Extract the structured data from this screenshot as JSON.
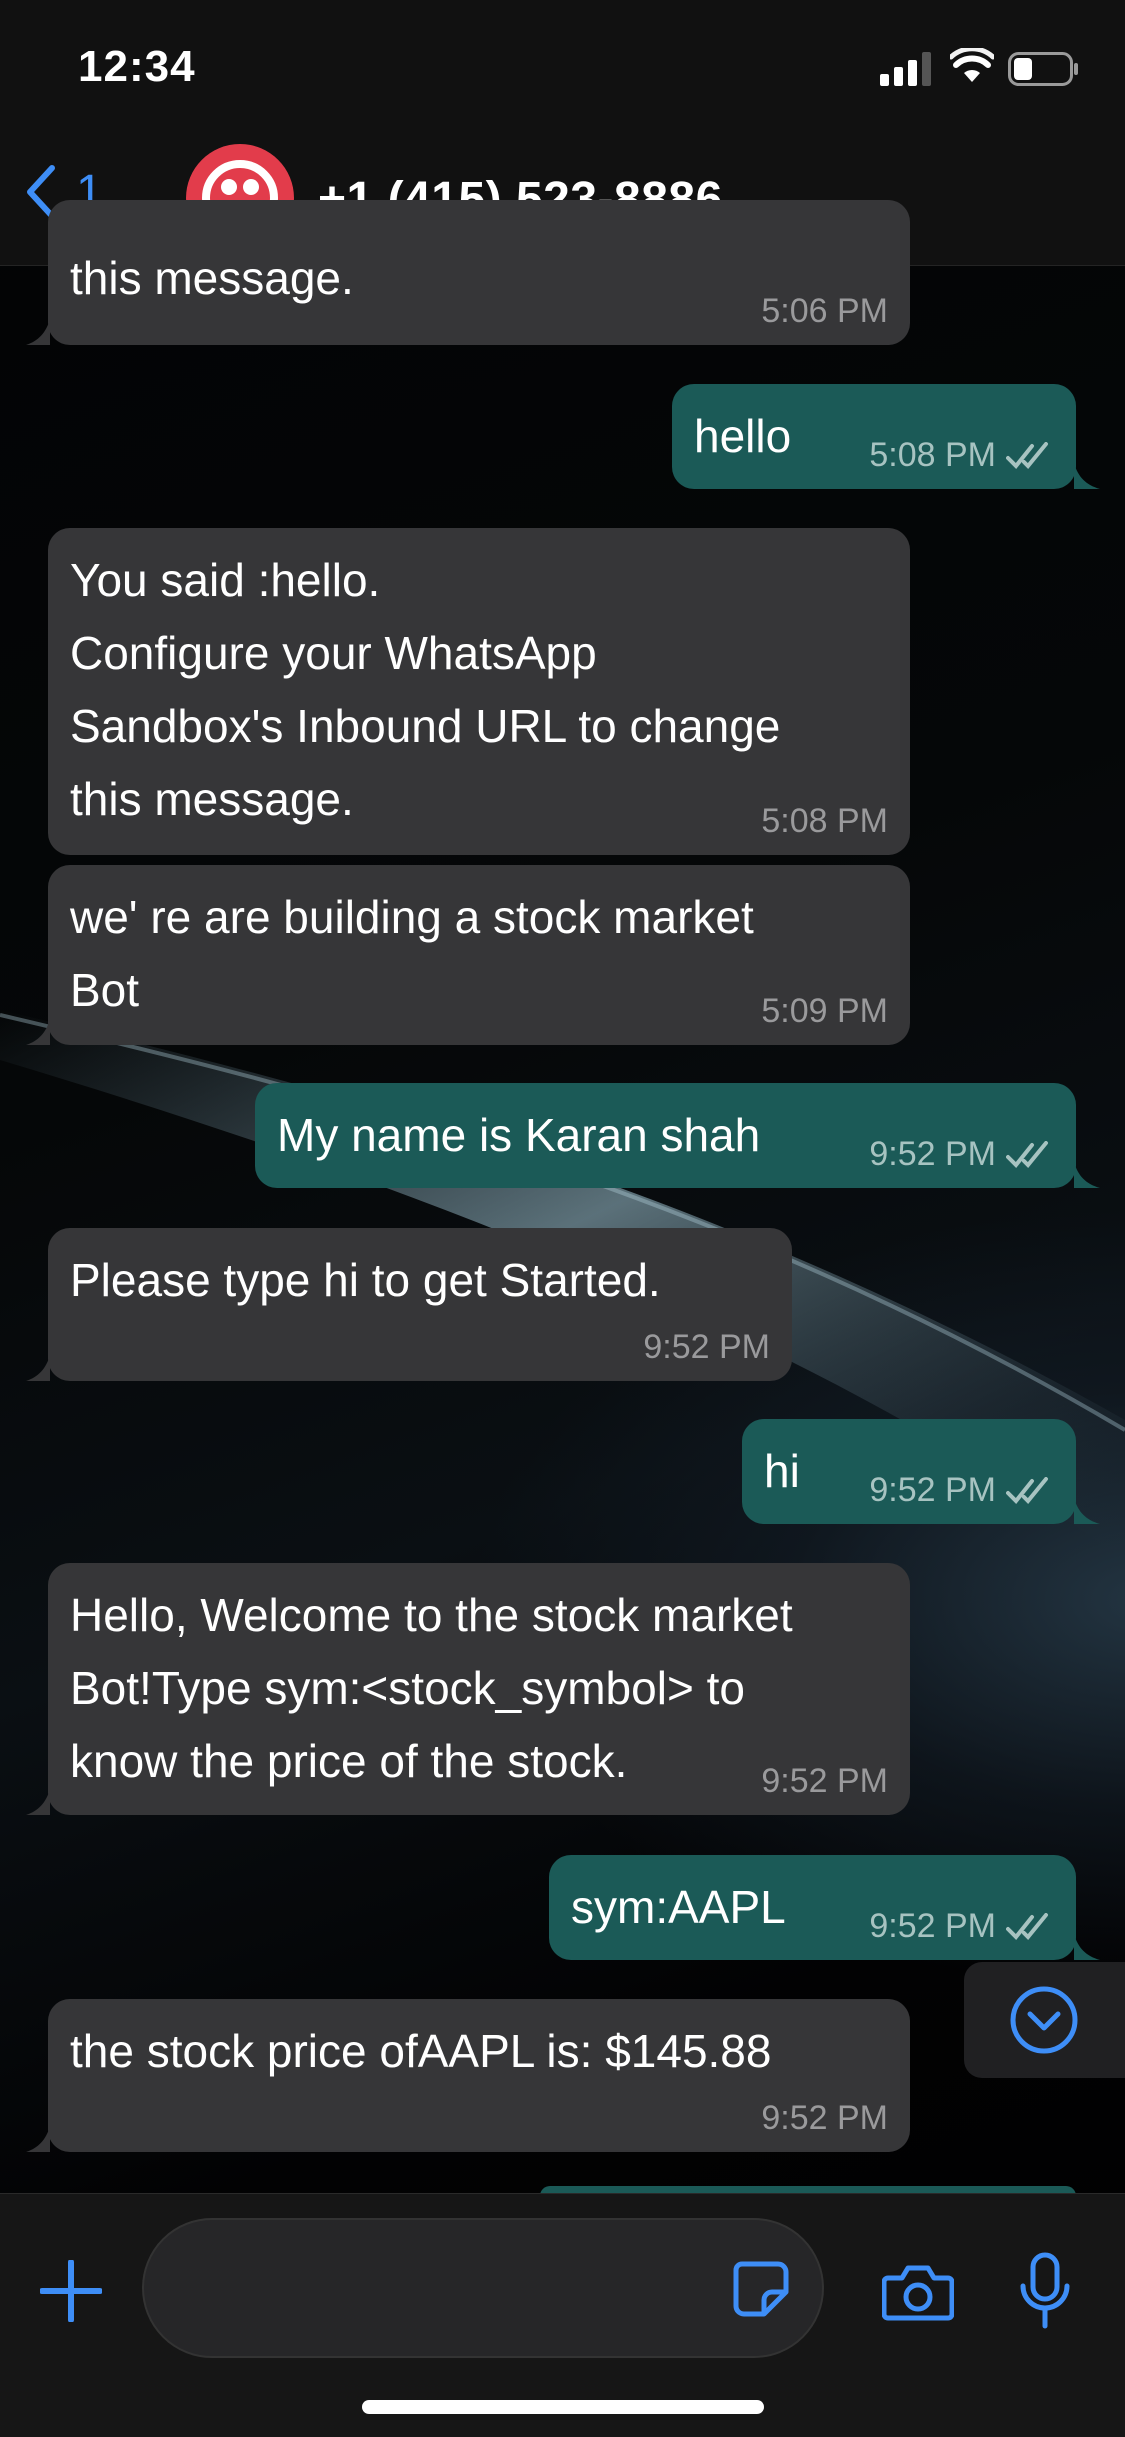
{
  "status_bar": {
    "time": "12:34"
  },
  "header": {
    "back_count": "1",
    "contact": "+1 (415) 523-8886"
  },
  "messages": [
    {
      "dir": "in",
      "text": "this message.",
      "time": "5:06 PM"
    },
    {
      "dir": "out",
      "text": "hello",
      "time": "5:08 PM"
    },
    {
      "dir": "in",
      "text": "You said :hello.\n Configure your WhatsApp\nSandbox's Inbound URL to change\nthis message.",
      "time": "5:08 PM"
    },
    {
      "dir": "in",
      "text": "we' re are building a stock market\nBot",
      "time": "5:09 PM"
    },
    {
      "dir": "out",
      "text": "My name is Karan shah",
      "time": "9:52 PM"
    },
    {
      "dir": "in",
      "text": "Please type hi to get Started.",
      "time": "9:52 PM"
    },
    {
      "dir": "out",
      "text": "hi",
      "time": "9:52 PM"
    },
    {
      "dir": "in",
      "text": "Hello, Welcome to the stock market\nBot!Type sym:<stock_symbol> to\nknow the price of the stock.",
      "time": "9:52 PM"
    },
    {
      "dir": "out",
      "text": "sym:AAPL",
      "time": "9:52 PM"
    },
    {
      "dir": "in",
      "text": "the stock price ofAAPL is: $145.88",
      "time": "9:52 PM"
    }
  ],
  "colors": {
    "accent": "#3e8ef7",
    "incoming_bubble": "#363638",
    "outgoing_bubble": "#1b5a57",
    "avatar": "#e23c4b"
  },
  "icons": [
    "back-chevron-icon",
    "plus-icon",
    "sticker-icon",
    "camera-icon",
    "mic-icon",
    "scroll-down-icon",
    "read-receipt-icon"
  ]
}
